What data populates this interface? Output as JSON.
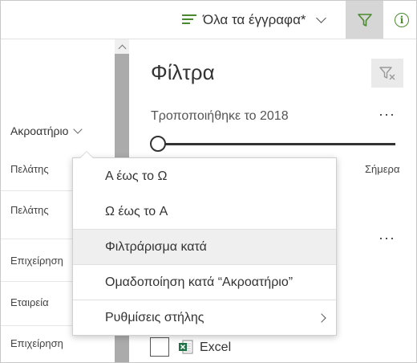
{
  "command_bar": {
    "view_label": "Όλα τα έγγραφα*",
    "accent_color": "#4a8a2e",
    "filter_icon": "filter-icon",
    "info_icon": "info-icon",
    "info_glyph": "i"
  },
  "list": {
    "column_header": "Ακροατήριο",
    "rows": [
      "Πελάτης",
      "Πελάτης",
      "Επιχείρηση",
      "Εταιρεία",
      "Επιχείρηση"
    ]
  },
  "filter_pane": {
    "title": "Φίλτρα",
    "clear_icon": "clear-filter-icon",
    "modified_label": "Τροποποιήθηκε το 2018",
    "more_glyph": "···",
    "slider_end_label": "Σήμερα",
    "slider_value": 0,
    "file_type_label": "Excel"
  },
  "context_menu": {
    "items": [
      {
        "label": "A έως το Ω"
      },
      {
        "label": "Ω έως το A"
      },
      {
        "label": "Φιλτράρισμα κατά"
      },
      {
        "label": "Ομαδοποίηση κατά “Ακροατήριο”"
      },
      {
        "label": "Ρυθμίσεις στήλης"
      }
    ]
  }
}
